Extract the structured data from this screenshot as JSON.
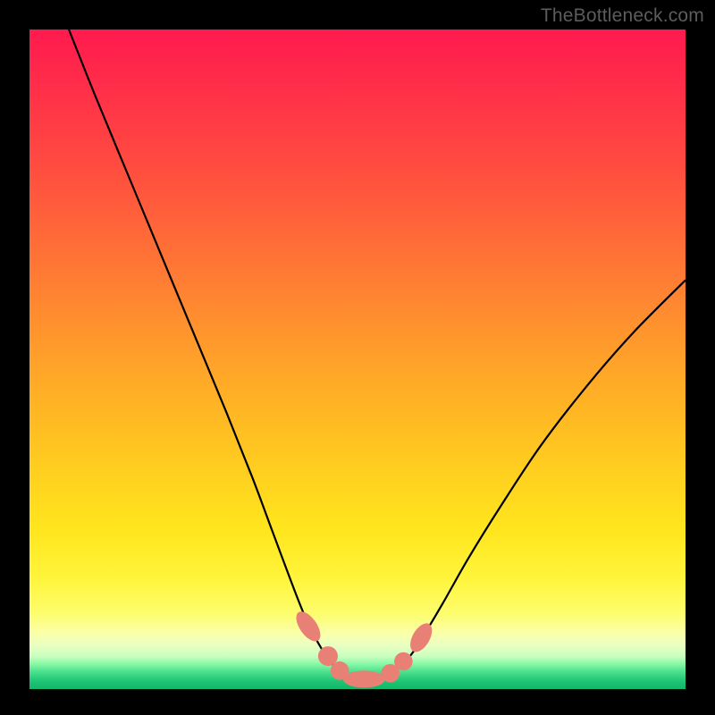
{
  "watermark": "TheBottleneck.com",
  "colors": {
    "frame": "#000000",
    "curve": "#000000",
    "marker_fill": "#e98076",
    "marker_stroke": "#e98076"
  },
  "chart_data": {
    "type": "line",
    "title": "",
    "xlabel": "",
    "ylabel": "",
    "xlim": [
      0,
      100
    ],
    "ylim": [
      0,
      100
    ],
    "series": [
      {
        "name": "bottleneck-curve",
        "x": [
          6,
          10,
          15,
          20,
          25,
          30,
          34,
          37,
          40,
          42,
          44,
          46,
          48,
          50,
          52,
          54,
          56,
          58,
          60,
          63,
          67,
          72,
          78,
          85,
          92,
          100
        ],
        "values": [
          100,
          90,
          78,
          66,
          54,
          42,
          32,
          24,
          16,
          11,
          7,
          4,
          2.2,
          1.5,
          1.5,
          2.1,
          3.3,
          5,
          8,
          13,
          20,
          28,
          37,
          46,
          54,
          62
        ]
      }
    ],
    "markers": [
      {
        "shape": "pill",
        "cx": 42.5,
        "cy": 9.5,
        "rx": 1.3,
        "ry": 2.6,
        "angle": -35
      },
      {
        "shape": "round",
        "cx": 45.5,
        "cy": 5.0,
        "r": 1.5
      },
      {
        "shape": "round",
        "cx": 47.3,
        "cy": 2.8,
        "r": 1.4
      },
      {
        "shape": "pill",
        "cx": 51.0,
        "cy": 1.5,
        "rx": 3.2,
        "ry": 1.3,
        "angle": 0
      },
      {
        "shape": "round",
        "cx": 55.0,
        "cy": 2.4,
        "r": 1.4
      },
      {
        "shape": "round",
        "cx": 57.0,
        "cy": 4.2,
        "r": 1.4
      },
      {
        "shape": "pill",
        "cx": 59.7,
        "cy": 7.8,
        "rx": 1.3,
        "ry": 2.4,
        "angle": 30
      }
    ]
  }
}
